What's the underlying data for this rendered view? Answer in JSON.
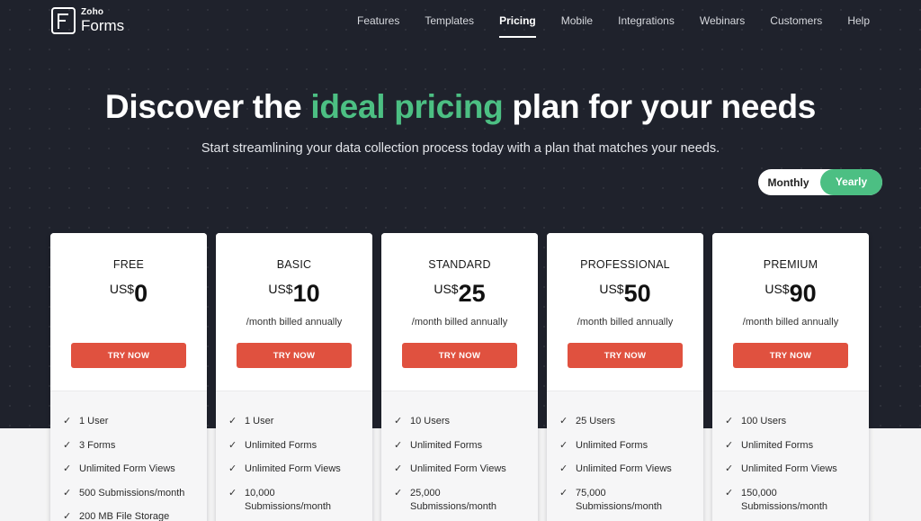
{
  "logo": {
    "brand": "Zoho",
    "product": "Forms"
  },
  "nav": {
    "items": [
      {
        "label": "Features",
        "active": false
      },
      {
        "label": "Templates",
        "active": false
      },
      {
        "label": "Pricing",
        "active": true
      },
      {
        "label": "Mobile",
        "active": false
      },
      {
        "label": "Integrations",
        "active": false
      },
      {
        "label": "Webinars",
        "active": false
      },
      {
        "label": "Customers",
        "active": false
      },
      {
        "label": "Help",
        "active": false
      }
    ]
  },
  "hero": {
    "headline_pre": "Discover the ",
    "headline_accent": "ideal pricing",
    "headline_post": " plan for your needs",
    "subline": "Start streamlining your data collection process today with a plan that matches your needs."
  },
  "toggle": {
    "monthly": "Monthly",
    "yearly": "Yearly",
    "selected": "Yearly"
  },
  "colors": {
    "accent_green": "#4cbf83",
    "cta_red": "#e0513f",
    "hero_bg": "#1f222c"
  },
  "plans": [
    {
      "name": "FREE",
      "currency": "US$",
      "amount": "0",
      "billing": "",
      "cta": "TRY NOW",
      "features": [
        "1 User",
        "3 Forms",
        "Unlimited Form Views",
        "500 Submissions/month",
        "200 MB File Storage"
      ]
    },
    {
      "name": "BASIC",
      "currency": "US$",
      "amount": "10",
      "billing": "/month billed annually",
      "cta": "TRY NOW",
      "features": [
        "1 User",
        "Unlimited Forms",
        "Unlimited Form Views",
        "10,000 Submissions/month"
      ]
    },
    {
      "name": "STANDARD",
      "currency": "US$",
      "amount": "25",
      "billing": "/month billed annually",
      "cta": "TRY NOW",
      "features": [
        "10 Users",
        "Unlimited Forms",
        "Unlimited Form Views",
        "25,000 Submissions/month"
      ]
    },
    {
      "name": "PROFESSIONAL",
      "currency": "US$",
      "amount": "50",
      "billing": "/month billed annually",
      "cta": "TRY NOW",
      "features": [
        "25 Users",
        "Unlimited Forms",
        "Unlimited Form Views",
        "75,000 Submissions/month"
      ]
    },
    {
      "name": "PREMIUM",
      "currency": "US$",
      "amount": "90",
      "billing": "/month billed annually",
      "cta": "TRY NOW",
      "features": [
        "100 Users",
        "Unlimited Forms",
        "Unlimited Form Views",
        "150,000 Submissions/month"
      ]
    }
  ]
}
